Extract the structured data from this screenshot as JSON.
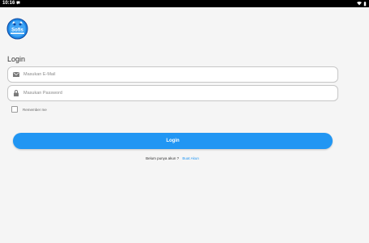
{
  "status_bar": {
    "time": "10:16",
    "notification_icon": "chat-bubble-icon",
    "icons": [
      "wifi-icon",
      "battery-icon"
    ]
  },
  "logo": {
    "text": "Sofis"
  },
  "login": {
    "title": "Login",
    "email_placeholder": "Masukan E-Mail",
    "email_value": "",
    "password_placeholder": "Masukan Password",
    "password_value": "",
    "remember_label": "Remember me",
    "remember_checked": false,
    "button_label": "Login",
    "signup_prompt": "Belum punya akun ?",
    "signup_link": "Buat Akun"
  },
  "colors": {
    "accent": "#2196f3",
    "background": "#f5f5f5"
  }
}
